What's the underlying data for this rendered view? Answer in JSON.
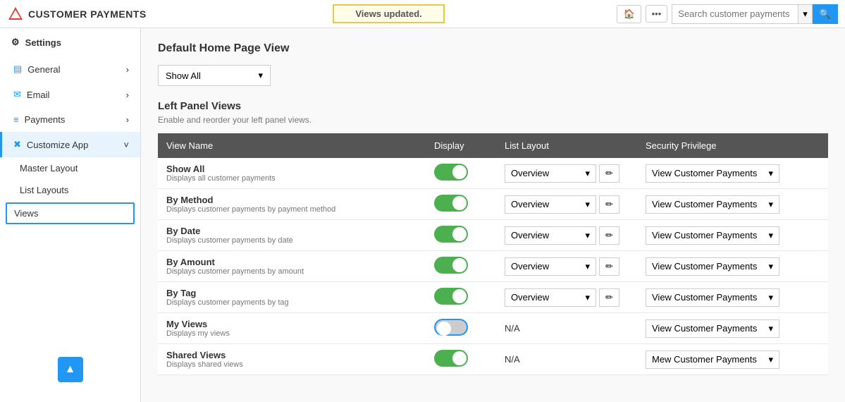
{
  "header": {
    "app_name": "CUSTOMER PAYMENTS",
    "banner": "Views updated.",
    "search_placeholder": "Search customer payments",
    "home_icon": "🏠",
    "more_icon": "•••",
    "search_icon": "🔍",
    "chevron_icon": "▾"
  },
  "sidebar": {
    "settings_label": "Settings",
    "gear_icon": "⚙",
    "nav_items": [
      {
        "id": "general",
        "label": "General",
        "icon": "▤",
        "has_arrow": true
      },
      {
        "id": "email",
        "label": "Email",
        "icon": "✉",
        "has_arrow": true
      },
      {
        "id": "payments",
        "label": "Payments",
        "icon": "≡",
        "has_arrow": true
      },
      {
        "id": "customize",
        "label": "Customize App",
        "icon": "✖",
        "has_arrow": true,
        "expanded": true
      }
    ],
    "sub_items": [
      {
        "id": "master-layout",
        "label": "Master Layout"
      },
      {
        "id": "list-layouts",
        "label": "List Layouts"
      },
      {
        "id": "views",
        "label": "Views",
        "active": true
      }
    ],
    "scroll_up_icon": "▲"
  },
  "content": {
    "default_view_title": "Default Home Page View",
    "default_view_value": "Show All",
    "left_panel_title": "Left Panel Views",
    "left_panel_sub": "Enable and reorder your left panel views.",
    "table_headers": [
      "View Name",
      "Display",
      "List Layout",
      "Security Privilege"
    ],
    "views": [
      {
        "name": "Show All",
        "desc": "Displays all customer payments",
        "display": true,
        "layout": "Overview",
        "privilege": "View Customer Payments"
      },
      {
        "name": "By Method",
        "desc": "Displays customer payments by payment method",
        "display": true,
        "layout": "Overview",
        "privilege": "View Customer Payments"
      },
      {
        "name": "By Date",
        "desc": "Displays customer payments by date",
        "display": true,
        "layout": "Overview",
        "privilege": "View Customer Payments"
      },
      {
        "name": "By Amount",
        "desc": "Displays customer payments by amount",
        "display": true,
        "layout": "Overview",
        "privilege": "View Customer Payments"
      },
      {
        "name": "By Tag",
        "desc": "Displays customer payments by tag",
        "display": true,
        "layout": "Overview",
        "privilege": "View Customer Payments"
      },
      {
        "name": "My Views",
        "desc": "Displays my views",
        "display": false,
        "layout": "N/A",
        "privilege": "View Customer Payments"
      },
      {
        "name": "Shared Views",
        "desc": "Displays shared views",
        "display": true,
        "layout": "N/A",
        "privilege": "Mew Customer Payments"
      }
    ]
  }
}
